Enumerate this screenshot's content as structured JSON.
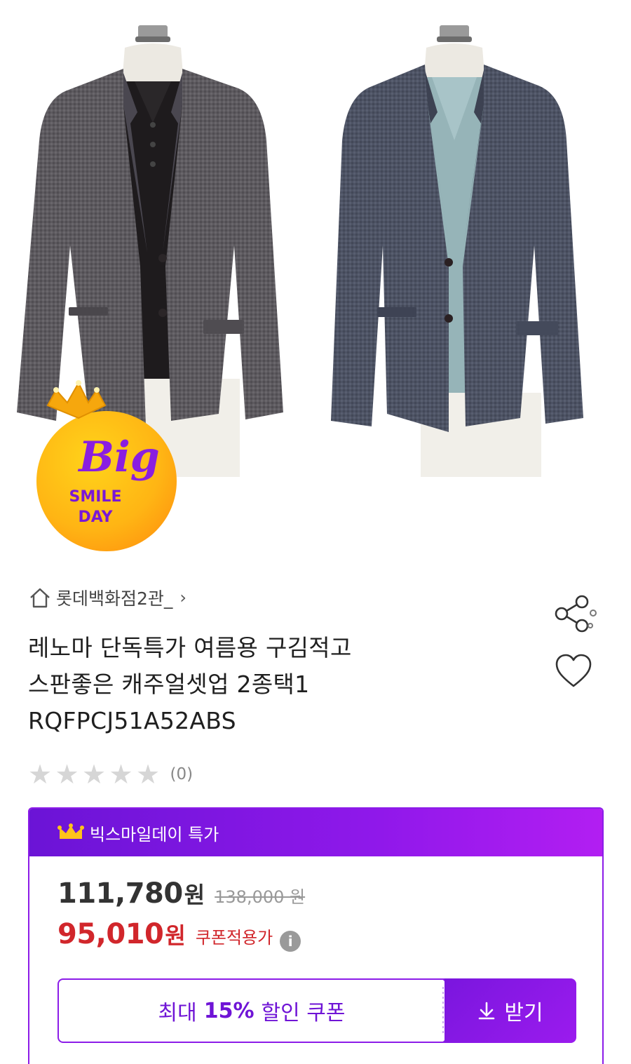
{
  "seller": {
    "name": "롯데백화점2관_",
    "home_icon": "home-icon",
    "arrow": "›"
  },
  "badge": {
    "line1": "Big",
    "line2": "SMILE",
    "line3": "DAY"
  },
  "product": {
    "title_line1": "레노마 단독특가 여름용 구김적고",
    "title_line2": "스판좋은 캐주얼셋업 2종택1",
    "title_line3": "RQFPCJ51A52ABS"
  },
  "rating": {
    "stars": 0,
    "max_stars": 5,
    "review_count": "(0)"
  },
  "promo": {
    "header_label": "빅스마일데이 특가",
    "price": "111,780",
    "price_unit": "원",
    "original_price": "138,000 원",
    "coupon_price": "95,010",
    "coupon_unit": "원",
    "coupon_label": "쿠폰적용가",
    "coupon_text_pre": "최대",
    "coupon_text_pct": "15%",
    "coupon_text_post": "할인 쿠폰",
    "download_label": "받기"
  },
  "colors": {
    "accent_purple": "#8c1ce8",
    "price_red": "#d1262b",
    "top_accent": "#e8413c"
  }
}
